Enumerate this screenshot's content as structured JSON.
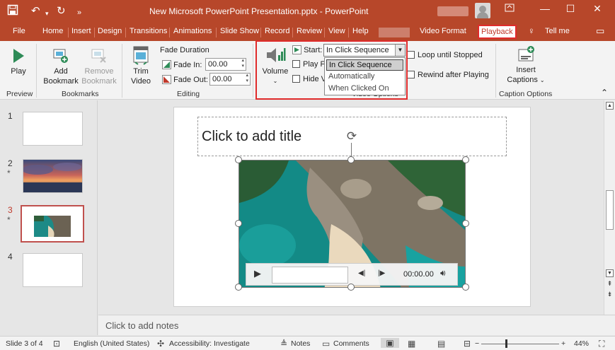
{
  "titlebar": {
    "doc_title": "New Microsoft PowerPoint Presentation.pptx",
    "app_name": "PowerPoint",
    "icons": [
      "save-icon",
      "undo-icon",
      "redo-icon",
      "more-icon"
    ],
    "window_controls": [
      "ribbon-display-icon",
      "minimize-icon",
      "maximize-icon",
      "close-icon"
    ]
  },
  "tabs": [
    "File",
    "Home",
    "Insert",
    "Design",
    "Transitions",
    "Animations",
    "Slide Show",
    "Record",
    "Review",
    "View",
    "Help",
    "Video Format",
    "Playback"
  ],
  "active_tab": "Playback",
  "tell_me": "Tell me",
  "ribbon": {
    "preview": {
      "play": "Play",
      "group": "Preview"
    },
    "bookmarks": {
      "add": "Add Bookmark",
      "add_line1": "Add",
      "add_line2": "Bookmark",
      "remove_line1": "Remove",
      "remove_line2": "Bookmark",
      "group": "Bookmarks"
    },
    "editing": {
      "trim_line1": "Trim",
      "trim_line2": "Video",
      "fade_duration": "Fade Duration",
      "fade_in_label": "Fade In:",
      "fade_in_value": "00.00",
      "fade_out_label": "Fade Out:",
      "fade_out_value": "00.00",
      "group": "Editing"
    },
    "video_options": {
      "volume": "Volume",
      "start_label": "Start:",
      "start_value": "In Click Sequence",
      "start_options": [
        "In Click Sequence",
        "Automatically",
        "When Clicked On"
      ],
      "play_full": "Play Fu",
      "hide": "Hide V",
      "loop": "Loop until Stopped",
      "rewind": "Rewind after Playing",
      "group_partial": "Video Options"
    },
    "captions": {
      "line1": "Insert",
      "line2": "Captions",
      "group": "Caption Options"
    }
  },
  "slides": [
    {
      "num": "1",
      "star": ""
    },
    {
      "num": "2",
      "star": "*"
    },
    {
      "num": "3",
      "star": "*"
    },
    {
      "num": "4",
      "star": ""
    }
  ],
  "current_slide": "3",
  "slide": {
    "title_placeholder": "Click to add title",
    "player_time": "00:00.00"
  },
  "notes_placeholder": "Click to add notes",
  "status": {
    "slide_info": "Slide 3 of 4",
    "language": "English (United States)",
    "accessibility": "Accessibility: Investigate",
    "notes": "Notes",
    "comments": "Comments",
    "zoom": "44%"
  },
  "colors": {
    "accent": "#b7472a",
    "highlight": "#e02b2b"
  }
}
